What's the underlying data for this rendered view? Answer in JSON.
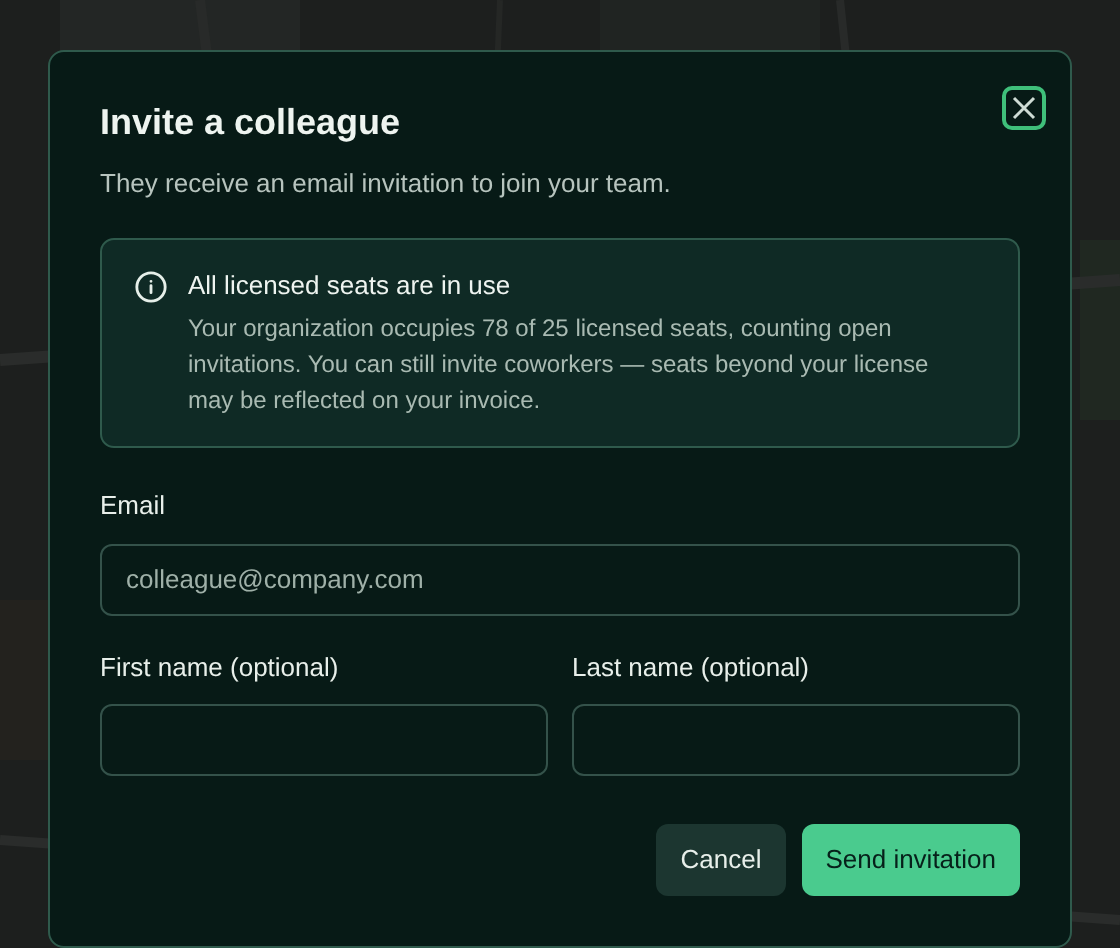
{
  "dialog": {
    "title": "Invite a colleague",
    "subtitle": "They receive an email invitation to join your team.",
    "notice": {
      "title": "All licensed seats are in use",
      "body": "Your organization occupies 78 of 25 licensed seats, counting open invitations. You can still invite coworkers — seats beyond your license may be reflected on your invoice."
    },
    "email_field": {
      "label": "Email",
      "placeholder": "colleague@company.com"
    },
    "name_fields": [
      {
        "label": "First name (optional)"
      },
      {
        "label": "Last name (optional)"
      }
    ],
    "buttons": [
      {
        "label": "Cancel",
        "kind": "secondary"
      },
      {
        "label": "Send invitation",
        "kind": "primary"
      }
    ]
  }
}
